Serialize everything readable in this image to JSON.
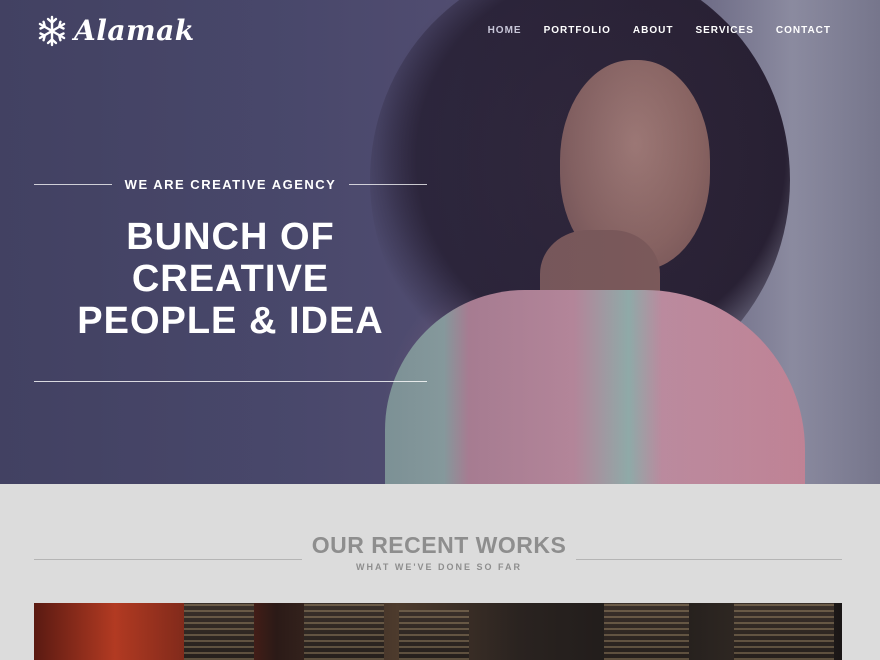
{
  "brand": {
    "name": "Alamak",
    "icon": "snowflake-icon"
  },
  "nav": {
    "items": [
      {
        "label": "HOME",
        "active": true
      },
      {
        "label": "PORTFOLIO",
        "active": false
      },
      {
        "label": "ABOUT",
        "active": false
      },
      {
        "label": "SERVICES",
        "active": false
      },
      {
        "label": "CONTACT",
        "active": false
      }
    ]
  },
  "hero": {
    "tagline": "WE ARE CREATIVE AGENCY",
    "headline": [
      "BUNCH OF",
      "CREATIVE",
      "PEOPLE & IDEA"
    ]
  },
  "works": {
    "title": "OUR RECENT WORKS",
    "subtitle": "WHAT WE'VE DONE SO FAR"
  },
  "colors": {
    "hero_overlay": "#3c3a5f",
    "section_bg": "#dcdcdc",
    "section_text": "#8e8e8e",
    "nav_active": "#c9c7d9"
  }
}
